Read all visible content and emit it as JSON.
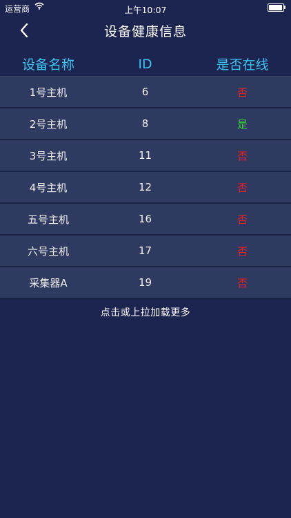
{
  "status_bar": {
    "carrier": "运营商",
    "time": "上午10:07"
  },
  "nav": {
    "title": "设备健康信息",
    "back_icon": "chevron-left-icon"
  },
  "table": {
    "headers": [
      "设备名称",
      "ID",
      "是否在线"
    ],
    "rows": [
      {
        "name": "1号主机",
        "id": "6",
        "online": "否"
      },
      {
        "name": "2号主机",
        "id": "8",
        "online": "是"
      },
      {
        "name": "3号主机",
        "id": "11",
        "online": "否"
      },
      {
        "name": "4号主机",
        "id": "12",
        "online": "否"
      },
      {
        "name": "五号主机",
        "id": "16",
        "online": "否"
      },
      {
        "name": "六号主机",
        "id": "17",
        "online": "否"
      },
      {
        "name": "采集器A",
        "id": "19",
        "online": "否"
      }
    ]
  },
  "load_more_label": "点击或上拉加载更多",
  "colors": {
    "background": "#1c2550",
    "row_background": "#2f3a60",
    "header_text": "#3cc3f2",
    "online_yes": "#33d833",
    "online_no": "#f01e1e"
  }
}
